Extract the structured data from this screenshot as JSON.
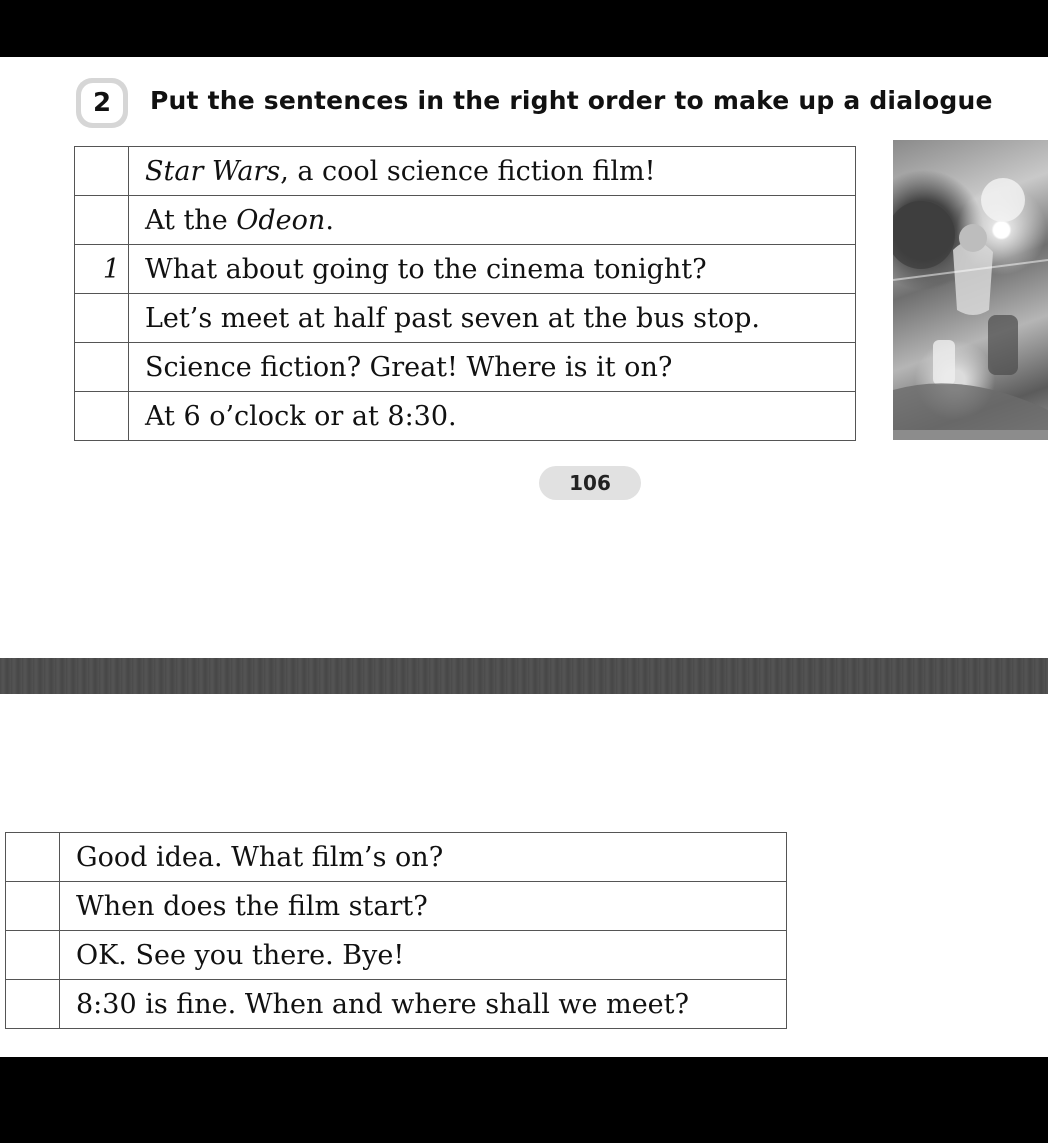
{
  "exercise": {
    "number": "2",
    "instruction": "Put the sentences in the right order to make up a dialogue"
  },
  "table_top": {
    "rows": [
      {
        "num": "",
        "parts": [
          {
            "text": "Star Wars",
            "italic": true
          },
          {
            "text": ", a cool science fiction film!",
            "italic": false
          }
        ]
      },
      {
        "num": "",
        "parts": [
          {
            "text": "At the ",
            "italic": false
          },
          {
            "text": "Odeon",
            "italic": true
          },
          {
            "text": ".",
            "italic": false
          }
        ]
      },
      {
        "num": "1",
        "parts": [
          {
            "text": "What about going to the cinema tonight?",
            "italic": false
          }
        ]
      },
      {
        "num": "",
        "parts": [
          {
            "text": "Let’s meet at half past seven at the bus stop.",
            "italic": false
          }
        ]
      },
      {
        "num": "",
        "parts": [
          {
            "text": "Science fiction? Great! Where is it on?",
            "italic": false
          }
        ]
      },
      {
        "num": "",
        "parts": [
          {
            "text": "At 6 o’clock or at 8:30.",
            "italic": false
          }
        ]
      }
    ]
  },
  "page_number": "106",
  "table_bottom": {
    "rows": [
      {
        "num": "",
        "parts": [
          {
            "text": "Good idea. What film’s on?",
            "italic": false
          }
        ]
      },
      {
        "num": "",
        "parts": [
          {
            "text": "When does the film start?",
            "italic": false
          }
        ]
      },
      {
        "num": "",
        "parts": [
          {
            "text": "OK. See you there. Bye!",
            "italic": false
          }
        ]
      },
      {
        "num": "",
        "parts": [
          {
            "text": "8:30 is fine. When and where shall we meet?",
            "italic": false
          }
        ]
      }
    ]
  },
  "poster": {
    "icon": "star-wars-poster-image"
  }
}
